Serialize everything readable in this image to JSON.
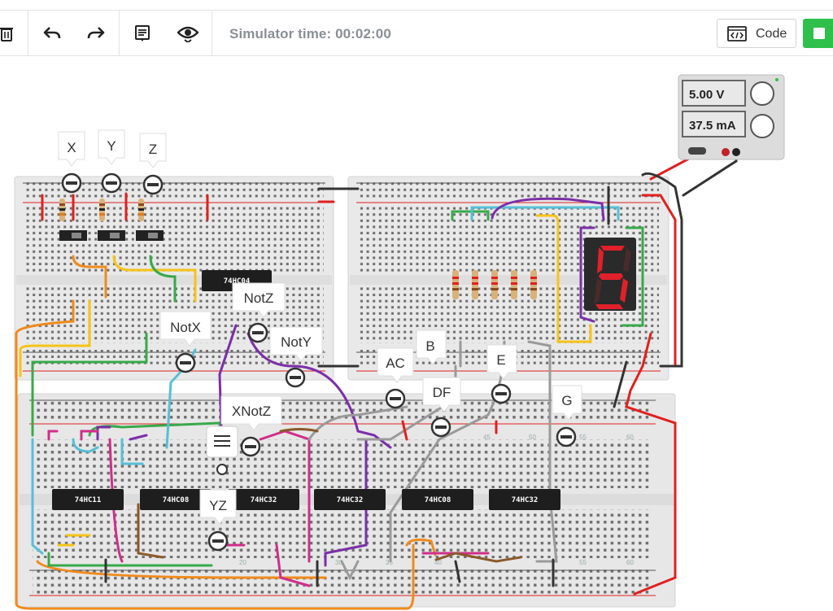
{
  "toolbar": {
    "sim_time": "Simulator time: 00:02:00",
    "code_label": "Code",
    "icons": [
      "trash-icon",
      "undo-icon",
      "redo-icon",
      "notes-icon",
      "eye-icon",
      "code-icon",
      "stop-icon"
    ]
  },
  "power_supply": {
    "voltage": "5.00 V",
    "current": "37.5 mA"
  },
  "chips": {
    "top": "74HC04",
    "b1": "74HC11",
    "b2": "74HC08",
    "b3": "74HC32",
    "b4": "74HC32",
    "b5": "74HC08",
    "b6": "74HC32"
  },
  "probes": {
    "x": "X",
    "y": "Y",
    "z": "Z",
    "notx": "NotX",
    "notz": "NotZ",
    "noty": "NotY",
    "xnotz": "XNotZ",
    "yz": "YZ",
    "ac": "AC",
    "b": "B",
    "df": "DF",
    "e": "E",
    "g": "G"
  },
  "board_numbers": {
    "b45": "45",
    "b50": "50",
    "b55": "55",
    "b60": "60",
    "b20": "20",
    "b30": "30",
    "b35": "35",
    "b40": "40",
    "bb55": "55",
    "bb60": "60"
  },
  "colors": {
    "accent_green": "#2fbf4b",
    "wire_red": "#e02020",
    "wire_purple": "#7b2fa8"
  }
}
